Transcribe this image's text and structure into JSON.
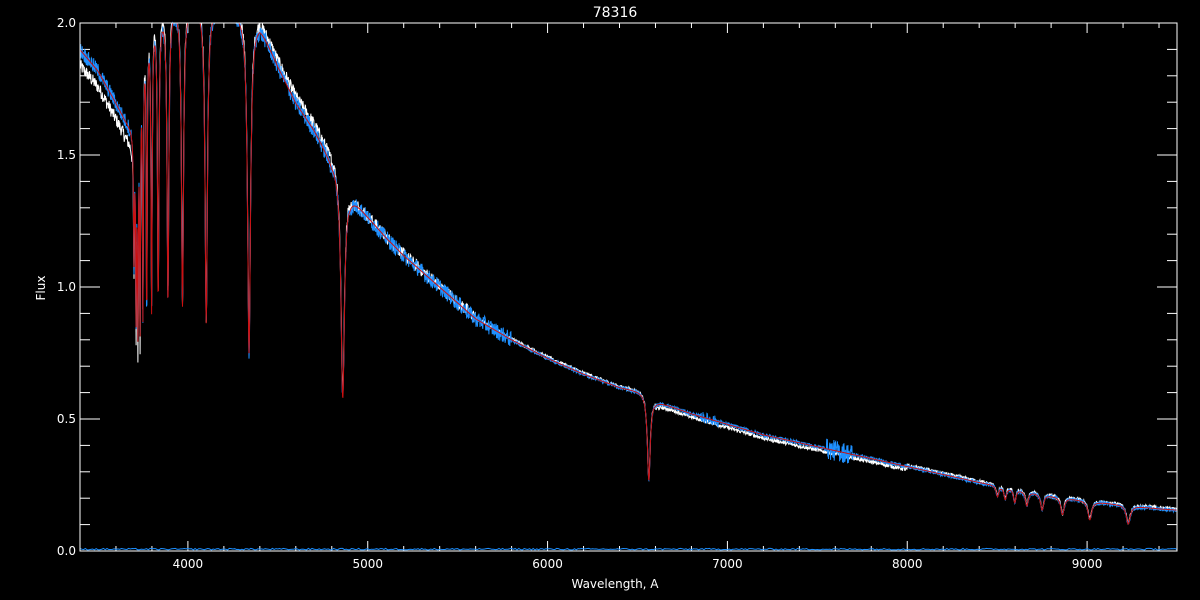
{
  "chart_data": {
    "type": "line",
    "title": "78316",
    "xlabel": "Wavelength, A",
    "ylabel": "Flux",
    "xlim": [
      3400,
      9500
    ],
    "ylim": [
      0,
      2.0
    ],
    "x_ticks": [
      4000,
      5000,
      6000,
      7000,
      8000,
      9000
    ],
    "x_tick_labels": [
      "4000",
      "5000",
      "6000",
      "7000",
      "8000",
      "9000"
    ],
    "y_ticks": [
      0,
      0.5,
      1.0,
      1.5,
      2.0
    ],
    "y_tick_labels": [
      "0.0",
      "0.5",
      "1.0",
      "1.5",
      "2.0"
    ],
    "x_minor_step": 200,
    "y_minor_step": 0.1,
    "grid": false,
    "background": "#000000",
    "axis_color": "#ffffff",
    "continuum": {
      "x": [
        3400,
        3450,
        3500,
        3550,
        3600,
        3650,
        3700,
        3720,
        3750,
        3800,
        3900,
        4000,
        4100,
        4200,
        4300,
        4350,
        4400,
        4500,
        4600,
        4700,
        4800,
        4860,
        4900,
        5000,
        5100,
        5200,
        5300,
        5400,
        5500,
        5600,
        5800,
        6000,
        6200,
        6400,
        6560,
        6600,
        6800,
        7000,
        7200,
        7400,
        7600,
        7800,
        8000,
        8200,
        8400,
        8600,
        8800,
        9000,
        9200,
        9400,
        9500
      ],
      "y": [
        1.9,
        1.86,
        1.82,
        1.76,
        1.7,
        1.64,
        1.6,
        1.72,
        1.95,
        2.05,
        2.08,
        2.08,
        2.07,
        2.06,
        2.04,
        2.03,
        2.0,
        1.84,
        1.7,
        1.6,
        1.48,
        1.46,
        1.36,
        1.27,
        1.19,
        1.12,
        1.06,
        1.0,
        0.94,
        0.88,
        0.8,
        0.73,
        0.67,
        0.62,
        0.6,
        0.57,
        0.52,
        0.48,
        0.44,
        0.41,
        0.38,
        0.35,
        0.32,
        0.29,
        0.26,
        0.235,
        0.21,
        0.19,
        0.175,
        0.16,
        0.155
      ]
    },
    "absorption_lines": [
      {
        "x": 3700,
        "depth": 0.45,
        "width": 3
      },
      {
        "x": 3712,
        "depth": 0.7,
        "width": 3
      },
      {
        "x": 3722,
        "depth": 0.8,
        "width": 3
      },
      {
        "x": 3734,
        "depth": 0.9,
        "width": 3
      },
      {
        "x": 3750,
        "depth": 1.0,
        "width": 3
      },
      {
        "x": 3771,
        "depth": 1.08,
        "width": 3
      },
      {
        "x": 3798,
        "depth": 1.1,
        "width": 4
      },
      {
        "x": 3835,
        "depth": 1.08,
        "width": 5
      },
      {
        "x": 3889,
        "depth": 1.12,
        "width": 6
      },
      {
        "x": 3970,
        "depth": 1.14,
        "width": 7
      },
      {
        "x": 4102,
        "depth": 1.2,
        "width": 8
      },
      {
        "x": 4340,
        "depth": 1.28,
        "width": 10
      },
      {
        "x": 4861,
        "depth": 0.88,
        "width": 12
      },
      {
        "x": 6563,
        "depth": 0.33,
        "width": 10
      },
      {
        "x": 8502,
        "depth": 0.04,
        "width": 8
      },
      {
        "x": 8545,
        "depth": 0.045,
        "width": 8
      },
      {
        "x": 8598,
        "depth": 0.05,
        "width": 8
      },
      {
        "x": 8665,
        "depth": 0.055,
        "width": 9
      },
      {
        "x": 8750,
        "depth": 0.06,
        "width": 10
      },
      {
        "x": 8863,
        "depth": 0.065,
        "width": 11
      },
      {
        "x": 9015,
        "depth": 0.07,
        "width": 12
      },
      {
        "x": 9229,
        "depth": 0.07,
        "width": 13
      }
    ],
    "series": [
      {
        "color": "#ffffff"
      },
      {
        "color": "#1e90ff"
      },
      {
        "color": "#cc1010"
      }
    ]
  }
}
